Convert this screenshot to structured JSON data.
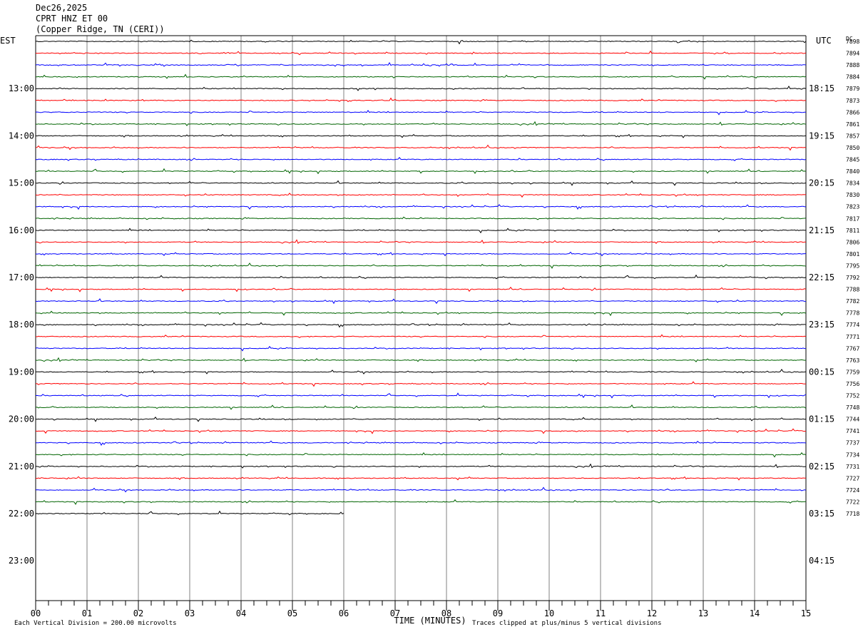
{
  "header": {
    "date": "Dec26,2025",
    "station": "CPRT HNZ ET 00",
    "location": "(Copper Ridge, TN (CERI))"
  },
  "left_axis_label": "EST",
  "right_axis_label": "UTC",
  "dc_label": "DC",
  "footer": {
    "xlabel": "TIME (MINUTES)",
    "scale_note": "Each Vertical Division =  200.00 microvolts",
    "clip_note": "Traces clipped at plus/minus 5 vertical divisions"
  },
  "colors": {
    "trace_cycle": [
      "#000000",
      "#ff0000",
      "#0000ff",
      "#006400"
    ],
    "grid": "#808080",
    "frame": "#000000"
  },
  "chart_data": {
    "type": "line",
    "title": "CPRT HNZ ET 00",
    "xlabel": "TIME (MINUTES)",
    "xlim": [
      0,
      15
    ],
    "x_ticks": [
      "00",
      "01",
      "02",
      "03",
      "04",
      "05",
      "06",
      "07",
      "08",
      "09",
      "10",
      "11",
      "12",
      "13",
      "14",
      "15"
    ],
    "left_hour_labels": [
      "13:00",
      "14:00",
      "15:00",
      "16:00",
      "17:00",
      "18:00",
      "19:00",
      "20:00",
      "21:00",
      "22:00",
      "23:00"
    ],
    "right_hour_labels": [
      "18:15",
      "19:15",
      "20:15",
      "21:15",
      "22:15",
      "23:15",
      "00:15",
      "01:15",
      "02:15",
      "03:15",
      "04:15"
    ],
    "rows_per_hour": 4,
    "first_row_start_est": "12:15",
    "trace_count": 41,
    "last_trace_end_minutes": 6,
    "dc_offsets": [
      7898,
      7894,
      7888,
      7884,
      7879,
      7873,
      7866,
      7861,
      7857,
      7850,
      7845,
      7840,
      7834,
      7830,
      7823,
      7817,
      7811,
      7806,
      7801,
      7795,
      7792,
      7788,
      7782,
      7778,
      7774,
      7771,
      7767,
      7763,
      7759,
      7756,
      7752,
      7748,
      7744,
      7741,
      7737,
      7734,
      7731,
      7727,
      7724,
      7722,
      7718
    ]
  }
}
